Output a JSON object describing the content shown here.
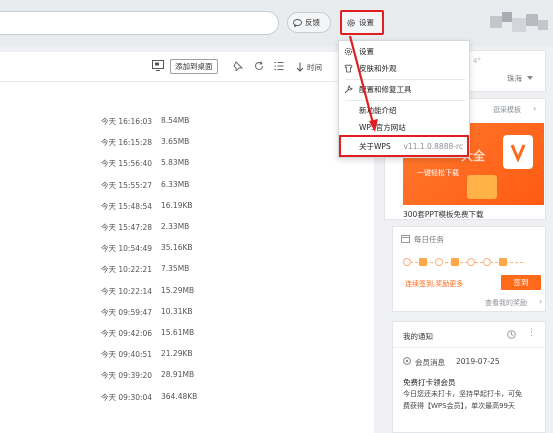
{
  "header": {
    "feedback_label": "反馈",
    "settings_label": "设置"
  },
  "toolbar": {
    "add_desktop": "添加到桌面",
    "time_label": "时间"
  },
  "files": [
    {
      "time": "今天 16:16:03",
      "size": "8.54MB"
    },
    {
      "time": "今天 16:15:28",
      "size": "3.65MB"
    },
    {
      "time": "今天 15:56:40",
      "size": "5.83MB"
    },
    {
      "time": "今天 15:55:27",
      "size": "6.33MB"
    },
    {
      "time": "今天 15:48:54",
      "size": "16.19KB"
    },
    {
      "time": "今天 15:47:28",
      "size": "2.33MB"
    },
    {
      "time": "今天 10:54:49",
      "size": "35.16KB"
    },
    {
      "time": "今天 10:22:21",
      "size": "7.35MB"
    },
    {
      "time": "今天 10:22:14",
      "size": "15.29MB"
    },
    {
      "time": "今天 09:59:47",
      "size": "10.31KB"
    },
    {
      "time": "今天 09:42:06",
      "size": "15.61MB"
    },
    {
      "time": "今天 09:40:51",
      "size": "21.29KB"
    },
    {
      "time": "今天 09:39:20",
      "size": "28.91MB"
    },
    {
      "time": "今天 09:30:04",
      "size": "364.48KB"
    }
  ],
  "menu": {
    "items": [
      {
        "label": "设置",
        "icon": "gear-icon"
      },
      {
        "label": "皮肤和外观",
        "icon": "skin-icon"
      },
      {
        "label": "配置和修复工具",
        "icon": "wrench-icon"
      },
      {
        "label": "新功能介绍"
      },
      {
        "label": "WPS官方网站"
      },
      {
        "label": "关于WPS",
        "version": "v11.1.0.8888-rc"
      }
    ]
  },
  "sidebar": {
    "weather_temp": "4°",
    "weather_city": "珠海",
    "template_link": "逛采模板",
    "banner_text": "一键轻松下载",
    "banner_caption": "300套PPT模板免费下载",
    "daily_task_title": "每日任务",
    "checkin_text": "连续签到,奖励更多",
    "checkin_button": "签到",
    "my_rewards_link": "查看我的奖励",
    "notice_title": "我的通知",
    "notice_source": "会员消息",
    "notice_date": "2019-07-25",
    "notice_headline": "免费打卡领会员",
    "notice_body_1": "今日您还未打卡，坚持早起打卡，可免",
    "notice_body_2": "费获得【WPS会员】，单次最高99天"
  },
  "colors": {
    "highlight_red": "#e02020",
    "banner_orange": "#ff6a1a",
    "checkin_orange": "#ff7a2e"
  }
}
